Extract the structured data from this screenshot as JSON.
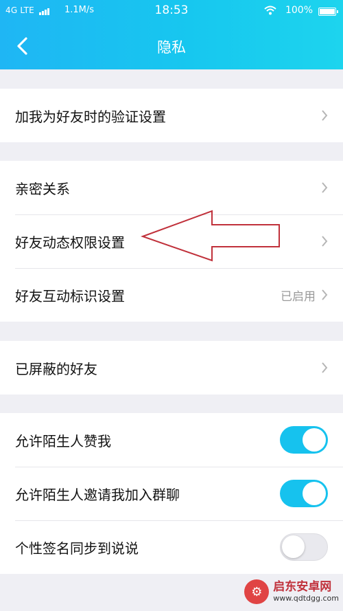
{
  "status_bar": {
    "network": "4G LTE",
    "speed": "1.1M/s",
    "time": "18:53",
    "battery": "100%"
  },
  "header": {
    "title": "隐私",
    "back_icon": "chevron-left-icon"
  },
  "sections": [
    {
      "items": [
        {
          "label": "加我为好友时的验证设置",
          "value": ""
        }
      ]
    },
    {
      "items": [
        {
          "label": "亲密关系",
          "value": ""
        },
        {
          "label": "好友动态权限设置",
          "value": ""
        },
        {
          "label": "好友互动标识设置",
          "value": "已启用"
        }
      ]
    },
    {
      "items": [
        {
          "label": "已屏蔽的好友",
          "value": ""
        }
      ]
    },
    {
      "items": [
        {
          "label": "允许陌生人赞我",
          "toggle": true
        },
        {
          "label": "允许陌生人邀请我加入群聊",
          "toggle": true
        },
        {
          "label": "个性签名同步到说说",
          "toggle": false
        }
      ]
    }
  ],
  "watermark": {
    "name": "启东安卓网",
    "url": "www.qdtdgg.com"
  },
  "colors": {
    "header_start": "#1fb6f4",
    "header_end": "#1dd4ee",
    "toggle_on": "#16c2ee",
    "annotation_arrow": "#c0303a"
  }
}
